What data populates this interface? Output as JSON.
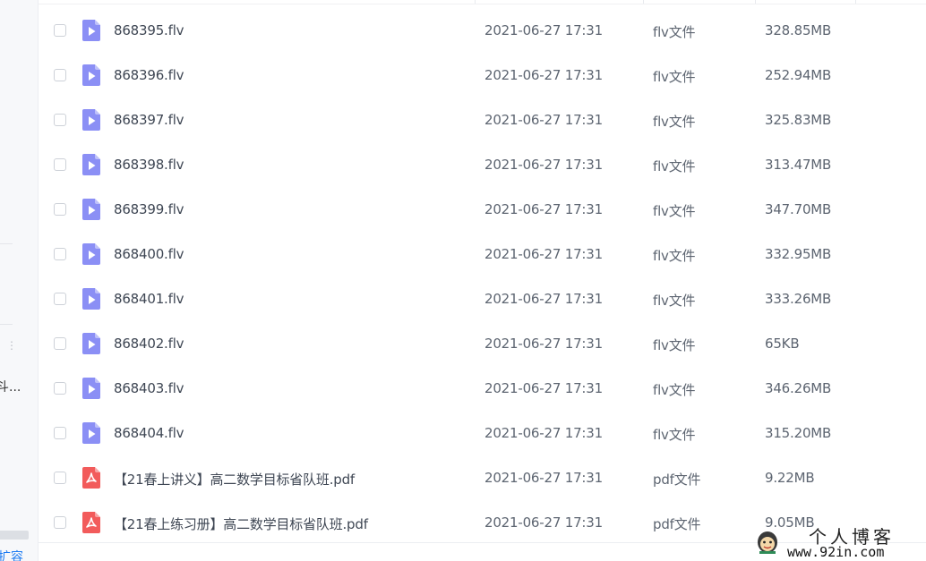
{
  "sidebar": {
    "more_glyph": "⋮",
    "truncated_label": "斗...",
    "expand_label": "扩容"
  },
  "files": [
    {
      "name": "868395.flv",
      "date": "2021-06-27 17:31",
      "type": "flv文件",
      "size": "328.85MB",
      "icon": "video-file-icon"
    },
    {
      "name": "868396.flv",
      "date": "2021-06-27 17:31",
      "type": "flv文件",
      "size": "252.94MB",
      "icon": "video-file-icon"
    },
    {
      "name": "868397.flv",
      "date": "2021-06-27 17:31",
      "type": "flv文件",
      "size": "325.83MB",
      "icon": "video-file-icon"
    },
    {
      "name": "868398.flv",
      "date": "2021-06-27 17:31",
      "type": "flv文件",
      "size": "313.47MB",
      "icon": "video-file-icon"
    },
    {
      "name": "868399.flv",
      "date": "2021-06-27 17:31",
      "type": "flv文件",
      "size": "347.70MB",
      "icon": "video-file-icon"
    },
    {
      "name": "868400.flv",
      "date": "2021-06-27 17:31",
      "type": "flv文件",
      "size": "332.95MB",
      "icon": "video-file-icon"
    },
    {
      "name": "868401.flv",
      "date": "2021-06-27 17:31",
      "type": "flv文件",
      "size": "333.26MB",
      "icon": "video-file-icon"
    },
    {
      "name": "868402.flv",
      "date": "2021-06-27 17:31",
      "type": "flv文件",
      "size": "65KB",
      "icon": "video-file-icon"
    },
    {
      "name": "868403.flv",
      "date": "2021-06-27 17:31",
      "type": "flv文件",
      "size": "346.26MB",
      "icon": "video-file-icon"
    },
    {
      "name": "868404.flv",
      "date": "2021-06-27 17:31",
      "type": "flv文件",
      "size": "315.20MB",
      "icon": "video-file-icon"
    },
    {
      "name": "【21春上讲义】高二数学目标省队班.pdf",
      "date": "2021-06-27 17:31",
      "type": "pdf文件",
      "size": "9.22MB",
      "icon": "pdf-file-icon"
    },
    {
      "name": "【21春上练习册】高二数学目标省队班.pdf",
      "date": "2021-06-27 17:31",
      "type": "pdf文件",
      "size": "9.05MB",
      "icon": "pdf-file-icon"
    }
  ],
  "watermark": {
    "title": "个人博客",
    "url": "www.92in.com"
  },
  "colors": {
    "video_icon": "#8b8ff5",
    "pdf_icon": "#f25b5b",
    "link": "#1e7cf2"
  }
}
